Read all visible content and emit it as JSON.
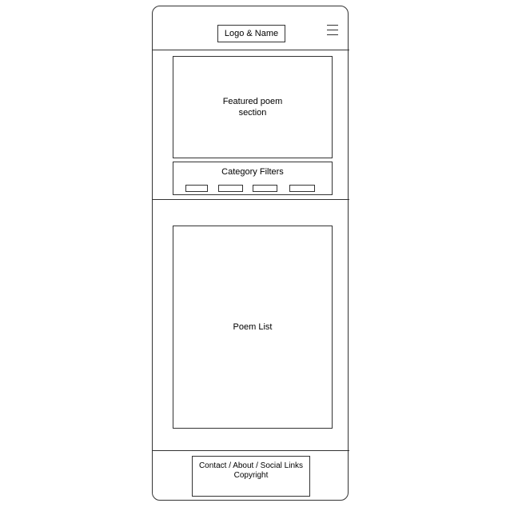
{
  "header": {
    "logo_label": "Logo & Name",
    "menu_icon": "hamburger-menu-icon"
  },
  "featured": {
    "label": "Featured poem\nsection"
  },
  "filters": {
    "title": "Category Filters",
    "chips": [
      "",
      "",
      "",
      ""
    ]
  },
  "poem_list": {
    "label": "Poem List"
  },
  "footer": {
    "line1": "Contact / About / Social Links",
    "line2": "Copyright"
  }
}
